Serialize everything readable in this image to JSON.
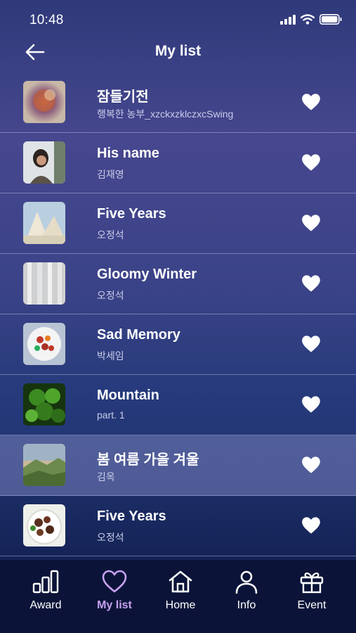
{
  "status": {
    "time": "10:48"
  },
  "header": {
    "title": "My list"
  },
  "songs": [
    {
      "title": "잠들기전",
      "artist": "행복한 농부_xzckxzklczxcSwing"
    },
    {
      "title": "His name",
      "artist": "김재영"
    },
    {
      "title": "Five Years",
      "artist": "오정석"
    },
    {
      "title": "Gloomy Winter",
      "artist": "오정석"
    },
    {
      "title": "Sad Memory",
      "artist": "박세임"
    },
    {
      "title": "Mountain",
      "artist": "part. 1"
    },
    {
      "title": "봄 여름 가을 겨울",
      "artist": "김옥"
    },
    {
      "title": "Five Years",
      "artist": "오정석"
    }
  ],
  "tabs": [
    {
      "label": "Award",
      "icon": "bar-chart-icon"
    },
    {
      "label": "My list",
      "icon": "heart-outline-icon",
      "active": true
    },
    {
      "label": "Home",
      "icon": "home-icon"
    },
    {
      "label": "Info",
      "icon": "user-icon"
    },
    {
      "label": "Event",
      "icon": "gift-icon"
    }
  ],
  "colors": {
    "active_tab": "#c7a2f0",
    "tabbar_bg": "#0b1438"
  }
}
